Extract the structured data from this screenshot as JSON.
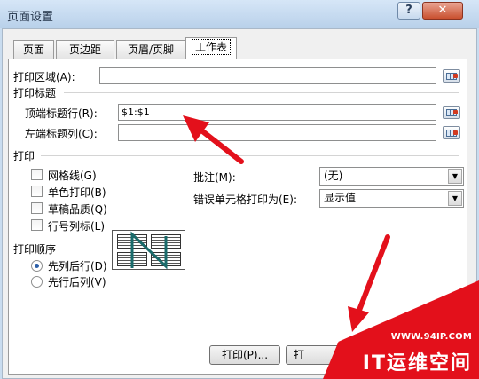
{
  "window": {
    "title": "页面设置",
    "help_label": "?",
    "close_label": "✕"
  },
  "tabs": [
    {
      "label": "页面"
    },
    {
      "label": "页边距"
    },
    {
      "label": "页眉/页脚"
    },
    {
      "label": "工作表"
    }
  ],
  "print_area": {
    "label": "打印区域(A):",
    "value": ""
  },
  "print_titles": {
    "heading": "打印标题",
    "rows_label": "顶端标题行(R):",
    "rows_value": "$1:$1",
    "cols_label": "左端标题列(C):",
    "cols_value": ""
  },
  "print": {
    "heading": "打印",
    "gridlines": "网格线(G)",
    "black_white": "单色打印(B)",
    "draft": "草稿品质(Q)",
    "row_col_headings": "行号列标(L)",
    "comments_label": "批注(M):",
    "comments_value": "(无)",
    "errors_label": "错误单元格打印为(E):",
    "errors_value": "显示值"
  },
  "page_order": {
    "heading": "打印顺序",
    "down_then_over": "先列后行(D)",
    "over_then_down": "先行后列(V)"
  },
  "buttons": {
    "print": "打印(P)...",
    "preview": "打"
  },
  "watermark": {
    "url": "WWW.94IP.COM",
    "brand": "IT运维空间"
  },
  "colors": {
    "arrow": "#e3101b",
    "title_bar": "#c9dcef"
  }
}
